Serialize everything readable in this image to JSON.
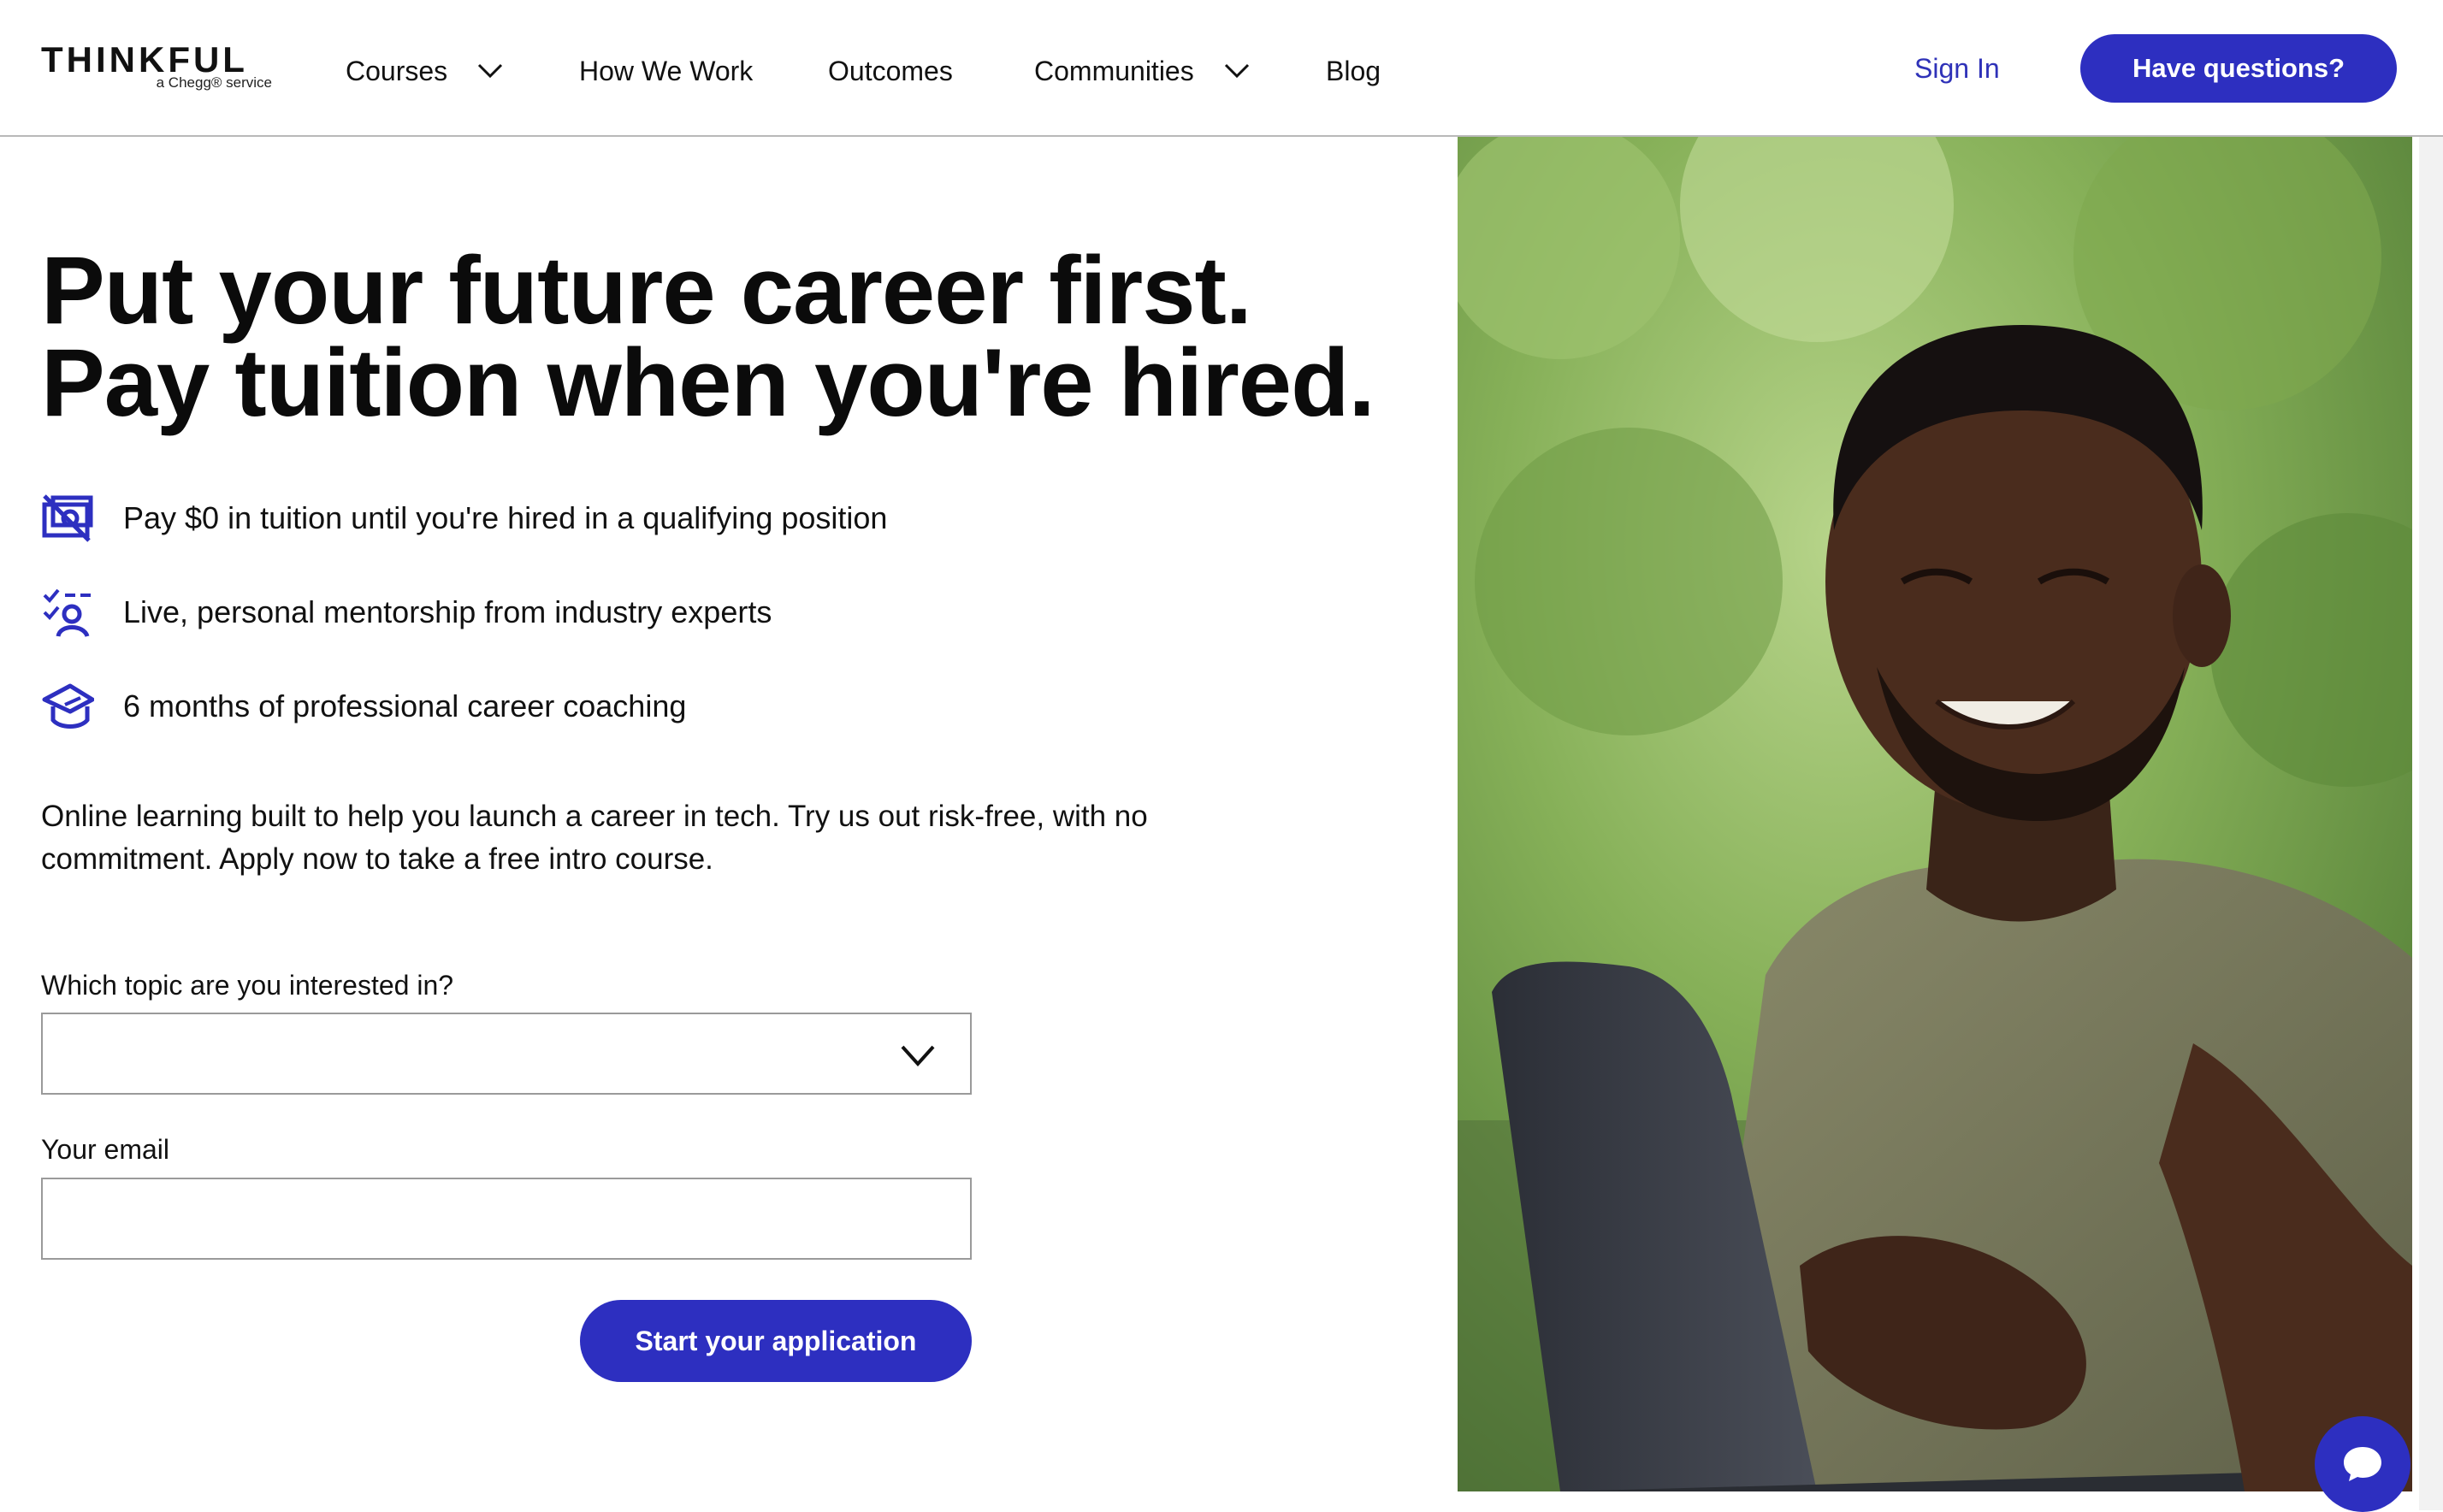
{
  "brand": {
    "name": "THINKFUL",
    "tagline": "a Chegg® service"
  },
  "nav": {
    "courses": "Courses",
    "how_we_work": "How We Work",
    "outcomes": "Outcomes",
    "communities": "Communities",
    "blog": "Blog",
    "sign_in": "Sign In",
    "cta": "Have questions?"
  },
  "hero": {
    "headline_line1": "Put your future career first.",
    "headline_line2": "Pay tuition when you're hired.",
    "features": [
      {
        "icon": "no-payment-icon",
        "text": "Pay $0 in tuition until you're hired in a qualifying position"
      },
      {
        "icon": "mentor-checklist-icon",
        "text": "Live, personal mentorship from industry experts"
      },
      {
        "icon": "graduation-cap-icon",
        "text": "6 months of professional career coaching"
      }
    ],
    "intro_line1": "Online learning built to help you launch a career in tech. Try us out risk-free, with no",
    "intro_line2": "commitment. Apply now to take a free intro course."
  },
  "form": {
    "topic_label": "Which topic are you interested in?",
    "topic_value": "",
    "email_label": "Your email",
    "email_value": "",
    "email_placeholder": "",
    "submit_label": "Start your application"
  },
  "colors": {
    "accent": "#2d2fc0",
    "link": "#2f32b8",
    "text": "#111111",
    "border": "#9a9a9a"
  },
  "photo": {
    "icon": "hero-photo"
  },
  "chat": {
    "icon": "chat-bubble-icon"
  }
}
